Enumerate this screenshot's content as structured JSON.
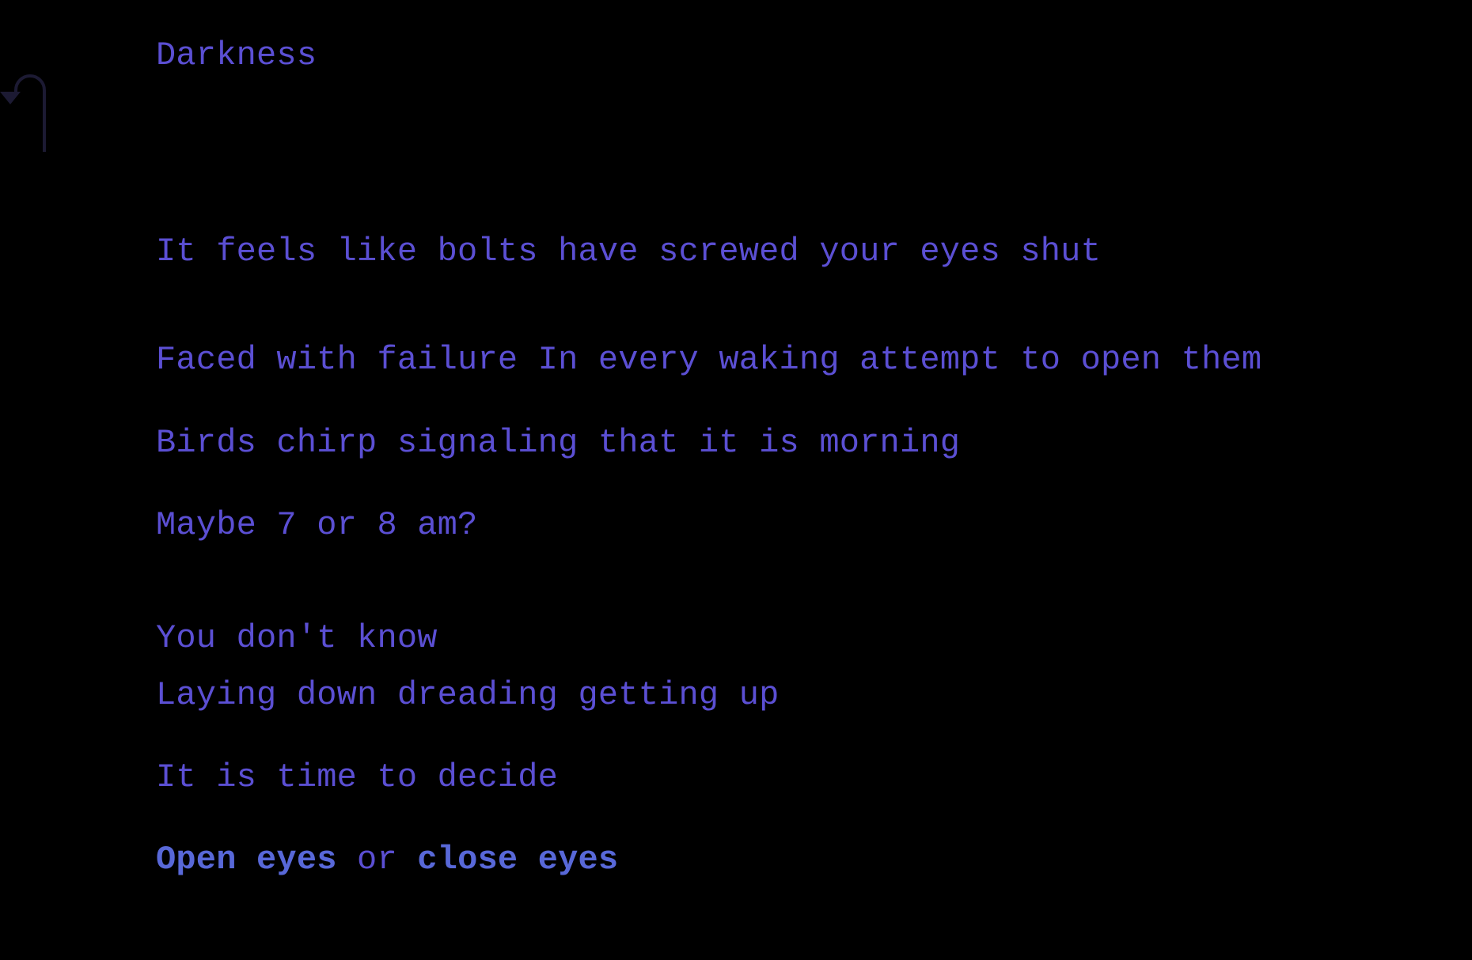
{
  "title": "Darkness",
  "passage": {
    "lines": [
      "It feels like bolts have screwed your eyes shut",
      "Faced with failure In every waking attempt to open them",
      "Birds chirp signaling that it is morning",
      "Maybe 7 or 8 am?",
      "You don't know",
      "Laying down dreading getting up",
      "It is time to decide"
    ]
  },
  "choices": {
    "open_label": "Open eyes",
    "separator": " or ",
    "close_label": "close eyes"
  },
  "icons": {
    "back": "undo-arrow-icon"
  },
  "colors": {
    "background": "#000000",
    "text": "#5b4fd3",
    "link": "#5868d8",
    "back_arrow": "#1c1a33"
  }
}
